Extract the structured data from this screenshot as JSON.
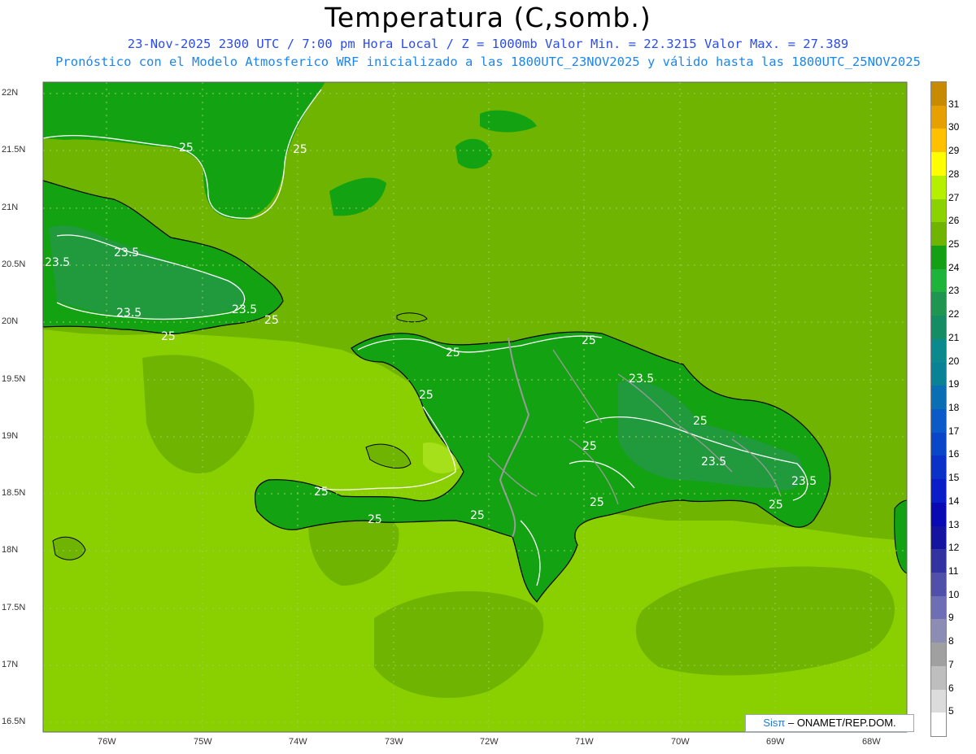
{
  "title": "Temperatura (C,somb.)",
  "subtitle_line1": "23-Nov-2025 2300 UTC / 7:00 pm Hora Local / Z = 1000mb   Valor Min. = 22.3215  Valor Max. = 27.389",
  "subtitle_line2": "Pronóstico con el Modelo Atmosferico WRF inicializado a las 1800UTC_23NOV2025 y válido hasta las  1800UTC_25NOV2025",
  "watermark": {
    "brand": "Sisπ",
    "org": " – ONAMET/REP.DOM."
  },
  "colors": {
    "subtitle": "#2a4cf0",
    "subtitle2": "#1b86f0",
    "ocean_main": "#6fb400",
    "ocean_light": "#8ad000",
    "ocean_lighter": "#a6e01a",
    "land_dark": "#12a212",
    "land_darker": "#209a3c",
    "contour": "#ffffff",
    "border": "#9a9a9a"
  },
  "axes": {
    "lat_labels": [
      "22N",
      "21.5N",
      "21N",
      "20.5N",
      "20N",
      "19.5N",
      "19N",
      "18.5N",
      "18N",
      "17.5N",
      "17N",
      "16.5N"
    ],
    "lon_labels": [
      "76W",
      "75W",
      "74W",
      "73W",
      "72W",
      "71W",
      "70W",
      "69W",
      "68W"
    ]
  },
  "contour_labels": [
    "25",
    "25",
    "23.5",
    "23.5",
    "23.5",
    "25",
    "25",
    "25",
    "25",
    "23.5",
    "25",
    "25",
    "23.5",
    "23.5",
    "25",
    "25",
    "25",
    "25",
    "25"
  ],
  "colorbar": {
    "values": [
      "31",
      "30",
      "29",
      "28",
      "27",
      "26",
      "25",
      "24",
      "23",
      "22",
      "21",
      "20",
      "19",
      "18",
      "17",
      "16",
      "15",
      "14",
      "13",
      "12",
      "11",
      "10",
      "9",
      "8",
      "7",
      "6",
      "5"
    ],
    "colors": [
      "#c88a00",
      "#e6a000",
      "#ffc000",
      "#ffff00",
      "#b4f000",
      "#8cd200",
      "#6eb400",
      "#14a014",
      "#1eb43c",
      "#1e9650",
      "#148c64",
      "#0a8a8c",
      "#0a8296",
      "#0a6eb4",
      "#0a5ac8",
      "#0a46c8",
      "#0a32c8",
      "#0a1ec8",
      "#0a0ab4",
      "#1414a0",
      "#3232a0",
      "#5050aa",
      "#6e6eb4",
      "#8c8cb4",
      "#a0a0a0",
      "#bebebe",
      "#dcdcdc",
      "#ffffff"
    ]
  }
}
